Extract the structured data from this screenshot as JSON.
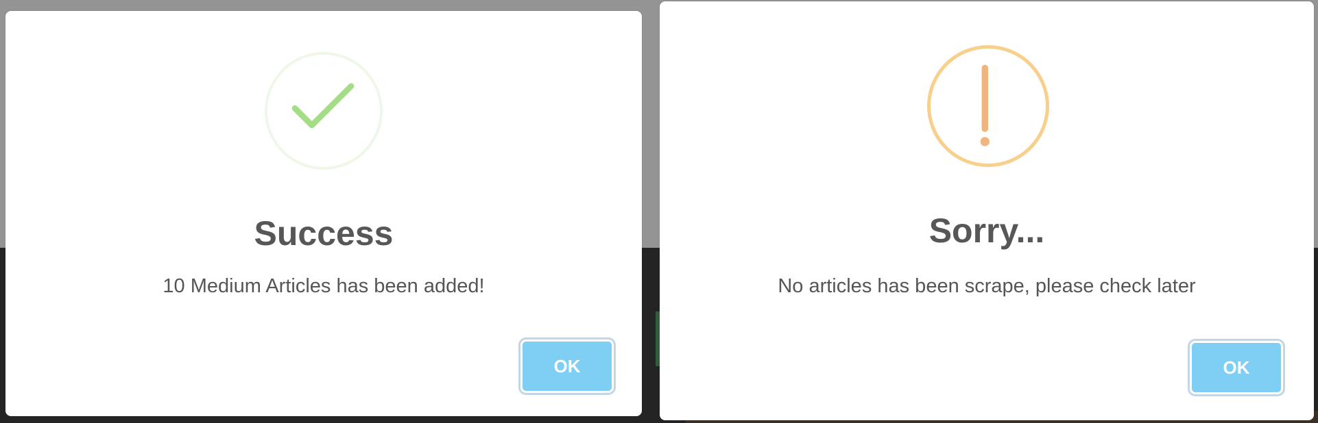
{
  "success_dialog": {
    "icon": "checkmark-icon",
    "title": "Success",
    "message": "10 Medium Articles has been added!",
    "button_label": "OK",
    "accent_color": "#a5dc86"
  },
  "warning_dialog": {
    "icon": "exclamation-icon",
    "title": "Sorry...",
    "message": "No articles has been scrape, please check later",
    "button_label": "OK",
    "accent_color": "#f8bb86"
  },
  "button_color": "#7fcff5"
}
